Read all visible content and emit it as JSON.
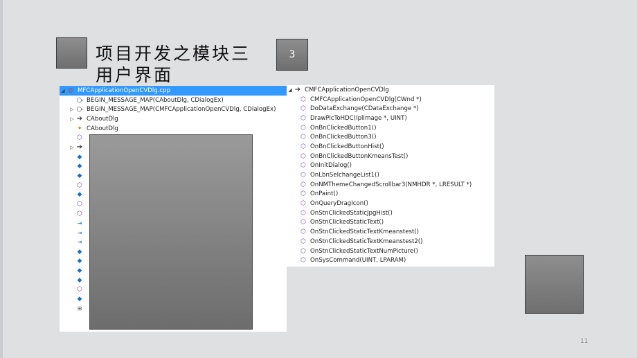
{
  "slide": {
    "title": "项目开发之模块三用户界面",
    "badge_number": "3",
    "page_number": "11"
  },
  "left_tree": {
    "root": {
      "label": "MFCApplicationOpenCVDlg.cpp",
      "icon": "cpp-file-icon"
    },
    "items": [
      {
        "label": "BEGIN_MESSAGE_MAP(CAboutDlg, CDialogEx)",
        "icon": "macro-icon",
        "expander": ""
      },
      {
        "label": "BEGIN_MESSAGE_MAP(CMFCApplicationOpenCVDlg, CDialogEx)",
        "icon": "macro-icon",
        "expander": "▷"
      },
      {
        "label": "CAboutDlg",
        "icon": "arrow-icon",
        "expander": "▷"
      },
      {
        "label": "CAboutDlg",
        "icon": "class-icon",
        "expander": ""
      },
      {
        "label": "",
        "icon": "method-icon",
        "expander": ""
      },
      {
        "label": "",
        "icon": "arrow-icon",
        "expander": "▷"
      },
      {
        "label": "",
        "icon": "field-icon",
        "expander": ""
      },
      {
        "label": "",
        "icon": "field-icon",
        "expander": ""
      },
      {
        "label": "",
        "icon": "field-icon",
        "expander": ""
      },
      {
        "label": "",
        "icon": "method-icon",
        "expander": ""
      },
      {
        "label": "",
        "icon": "field-icon",
        "expander": ""
      },
      {
        "label": "",
        "icon": "method-icon",
        "expander": ""
      },
      {
        "label": "",
        "icon": "method-icon",
        "expander": ""
      },
      {
        "label": "",
        "icon": "event-icon",
        "expander": ""
      },
      {
        "label": "",
        "icon": "event-icon",
        "expander": ""
      },
      {
        "label": "",
        "icon": "event-icon",
        "expander": ""
      },
      {
        "label": "",
        "icon": "field-icon",
        "expander": ""
      },
      {
        "label": "",
        "icon": "field-icon",
        "expander": ""
      },
      {
        "label": "",
        "icon": "field-icon",
        "expander": ""
      },
      {
        "label": "",
        "icon": "field-icon",
        "expander": ""
      },
      {
        "label": "",
        "icon": "method-icon",
        "expander": ""
      },
      {
        "label": "",
        "icon": "field-icon",
        "expander": ""
      },
      {
        "label": "",
        "icon": "namespace-icon",
        "expander": ""
      }
    ]
  },
  "right_tree": {
    "root": {
      "label": "CMFCApplicationOpenCVDlg",
      "icon": "arrow-icon"
    },
    "items": [
      "CMFCApplicationOpenCVDlg(CWnd *)",
      "DoDataExchange(CDataExchange *)",
      "DrawPicToHDC(IplImage *, UINT)",
      "OnBnClickedButton1()",
      "OnBnClickedButton3()",
      "OnBnClickedButtonHist()",
      "OnBnClickedButtonKmeansTest()",
      "OnInitDialog()",
      "OnLbnSelchangeList1()",
      "OnNMThemeChangedScrollbar3(NMHDR *, LRESULT *)",
      "OnPaint()",
      "OnQueryDragIcon()",
      "OnStnClickedStaticJpgHist()",
      "OnStnClickedStaticText()",
      "OnStnClickedStaticTextKmeanstest()",
      "OnStnClickedStaticTextKmeanstest2()",
      "OnStnClickedStaticTextNumPicture()",
      "OnSysCommand(UINT, LPARAM)"
    ]
  },
  "colors": {
    "selection": "#3399ff",
    "method_icon": "#8a3ab9",
    "field_icon": "#1c6fbf",
    "slide_bg": "#dfe0e2"
  }
}
